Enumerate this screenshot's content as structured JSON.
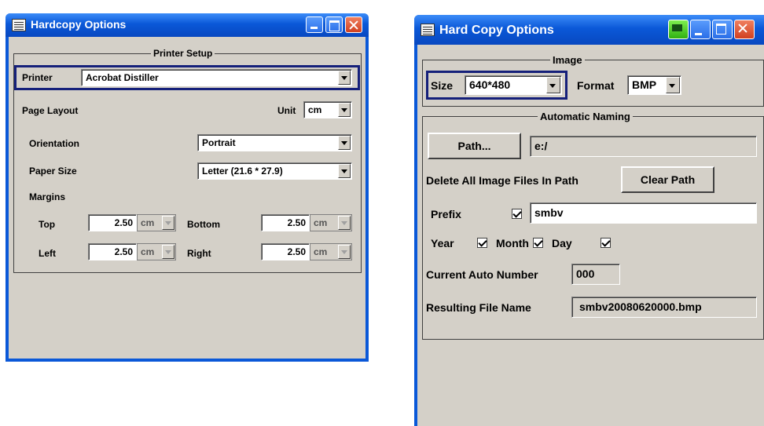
{
  "left_window": {
    "title": "Hardcopy Options",
    "group_title": "Printer Setup",
    "printer_label": "Printer",
    "printer_value": "Acrobat Distiller",
    "page_layout_label": "Page Layout",
    "unit_label": "Unit",
    "unit_value": "cm",
    "orientation_label": "Orientation",
    "orientation_value": "Portrait",
    "paper_size_label": "Paper Size",
    "paper_size_value": "Letter (21.6 * 27.9)",
    "margins_label": "Margins",
    "top_label": "Top",
    "top_value": "2.50",
    "bottom_label": "Bottom",
    "bottom_value": "2.50",
    "left_label": "Left",
    "left_value": "2.50",
    "right_label": "Right",
    "right_value": "2.50",
    "margin_unit": "cm"
  },
  "right_window": {
    "title": "Hard Copy Options",
    "image_group_title": "Image",
    "size_label": "Size",
    "size_value": "640*480",
    "format_label": "Format",
    "format_value": "BMP",
    "naming_group_title": "Automatic Naming",
    "path_button": "Path...",
    "path_value": "e:/",
    "delete_label": "Delete All Image Files In Path",
    "clear_path_button": "Clear Path",
    "prefix_label": "Prefix",
    "prefix_value": "smbv",
    "year_label": "Year",
    "month_label": "Month",
    "day_label": "Day",
    "current_number_label": "Current Auto Number",
    "current_number_value": "000",
    "resulting_label": "Resulting File Name",
    "resulting_value": "smbv20080620000.bmp"
  }
}
